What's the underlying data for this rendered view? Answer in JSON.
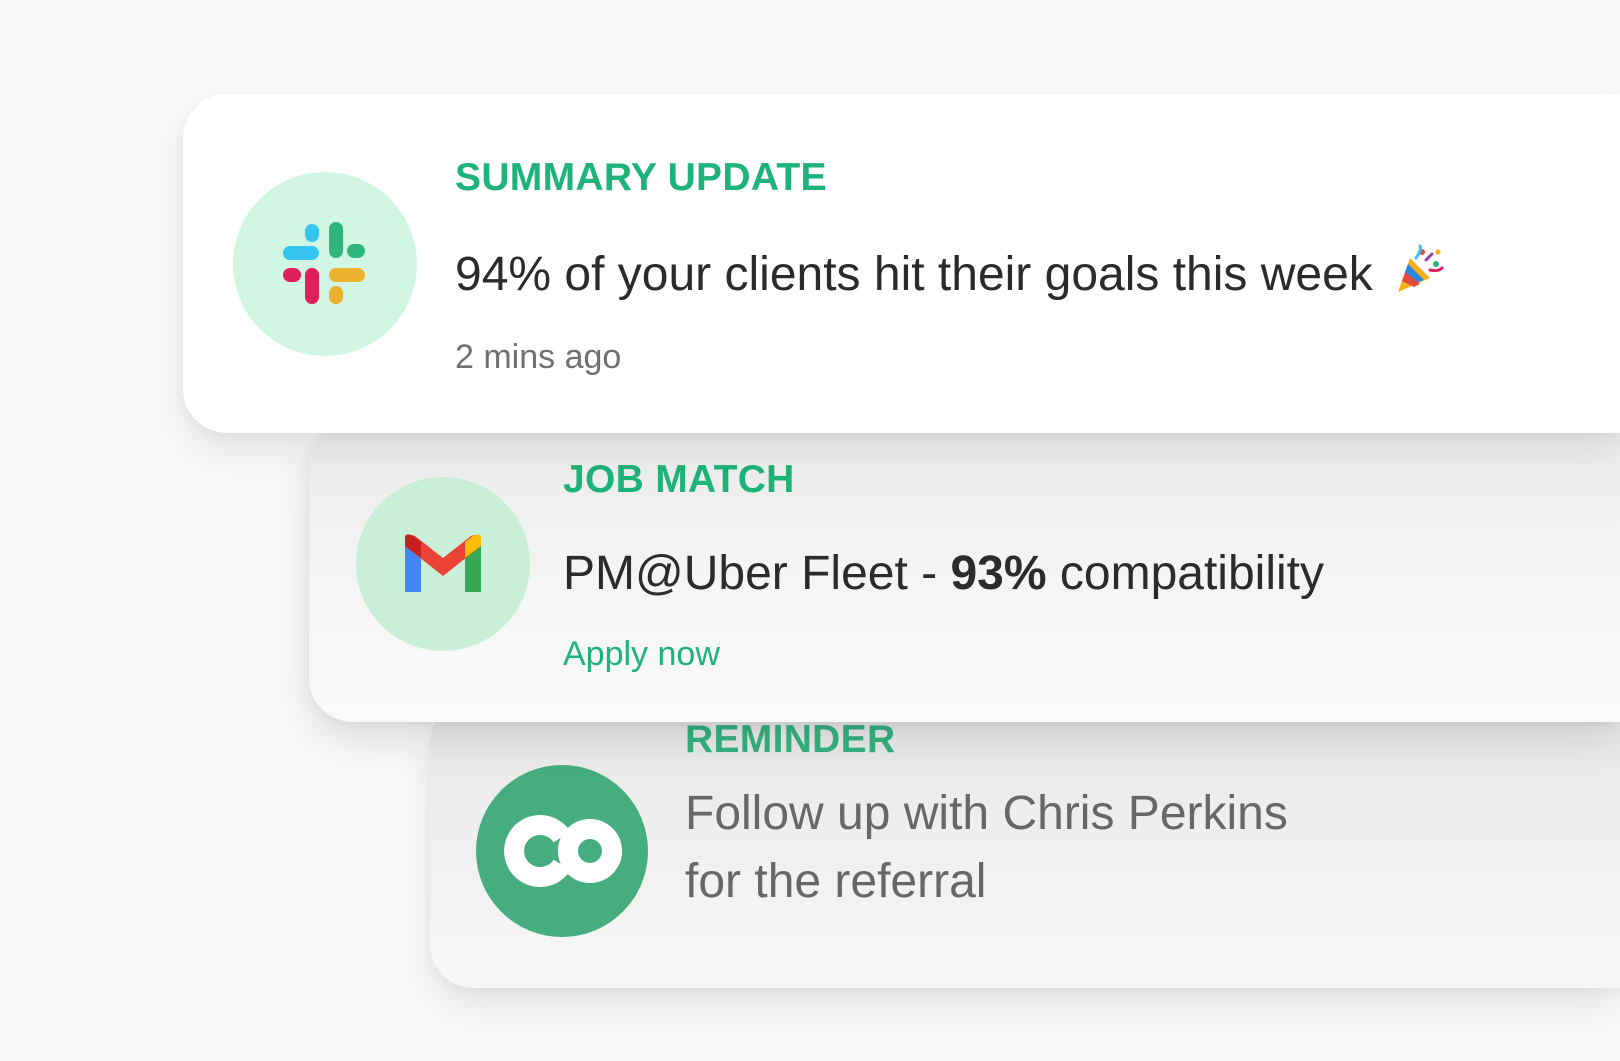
{
  "notifications": [
    {
      "category": "SUMMARY UPDATE",
      "message": "94% of your clients hit their goals this week",
      "emoji": "party-popper-icon",
      "time": "2 mins ago",
      "icon": "slack-logo-icon"
    },
    {
      "category": "JOB MATCH",
      "message_prefix": "PM@Uber Fleet - ",
      "message_highlight": "93%",
      "message_suffix": " compatibility",
      "action": "Apply now",
      "icon": "gmail-logo-icon"
    },
    {
      "category": "REMINDER",
      "message_line1": "Follow up with Chris Perkins",
      "message_line2": "for the referral",
      "icon": "co-logo-icon"
    }
  ],
  "colors": {
    "accent": "#1db37a",
    "avatar_light": "#d2f6e4",
    "avatar_dark": "#46ad7e",
    "text_dark": "#2b2b2b",
    "text_muted": "#707070"
  }
}
